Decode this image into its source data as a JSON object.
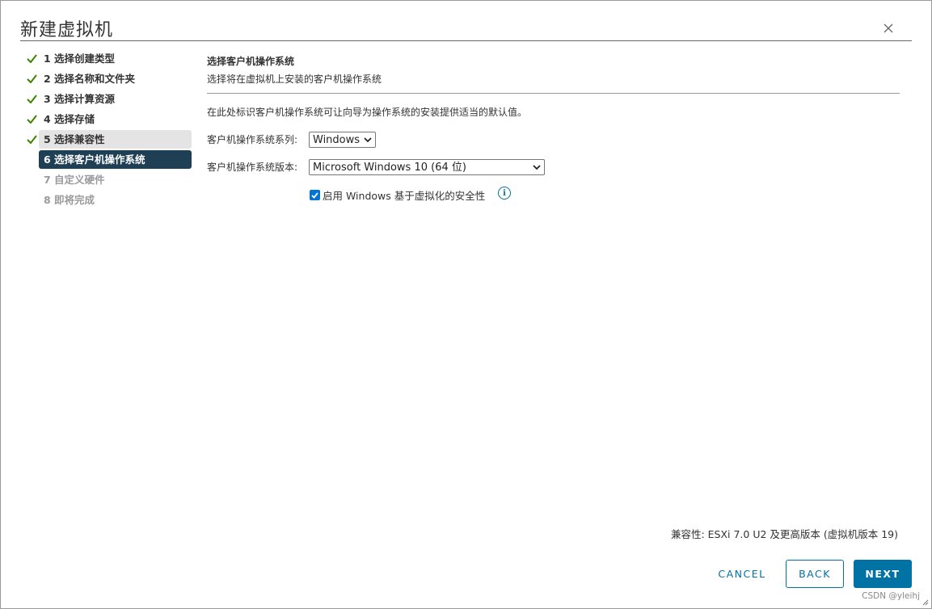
{
  "window": {
    "title": "新建虚拟机"
  },
  "steps": [
    {
      "label": "1 选择创建类型",
      "state": "done"
    },
    {
      "label": "2 选择名称和文件夹",
      "state": "done"
    },
    {
      "label": "3 选择计算资源",
      "state": "done"
    },
    {
      "label": "4 选择存储",
      "state": "done"
    },
    {
      "label": "5 选择兼容性",
      "state": "done-selected"
    },
    {
      "label": "6 选择客户机操作系统",
      "state": "active"
    },
    {
      "label": "7 自定义硬件",
      "state": "disabled"
    },
    {
      "label": "8 即将完成",
      "state": "disabled"
    }
  ],
  "main": {
    "title": "选择客户机操作系统",
    "subtitle": "选择将在虚拟机上安装的客户机操作系统",
    "description": "在此处标识客户机操作系统可让向导为操作系统的安装提供适当的默认值。",
    "os_family_label": "客户机操作系统系列:",
    "os_family_value": "Windows",
    "os_version_label": "客户机操作系统版本:",
    "os_version_value": "Microsoft Windows 10 (64 位)",
    "vbs_checkbox_label": "启用 Windows 基于虚拟化的安全性",
    "vbs_checked": true,
    "info_glyph": "i"
  },
  "footer": {
    "compatibility": "兼容性: ESXi 7.0 U2 及更高版本 (虚拟机版本 19)",
    "cancel_label": "CANCEL",
    "back_label": "BACK",
    "next_label": "NEXT",
    "watermark": "CSDN @yleihj"
  },
  "colors": {
    "accent": "#0072a3",
    "active_step_bg": "#1f3f55",
    "selected_step_bg": "#e4e4e4",
    "check_green": "#3c8500"
  }
}
